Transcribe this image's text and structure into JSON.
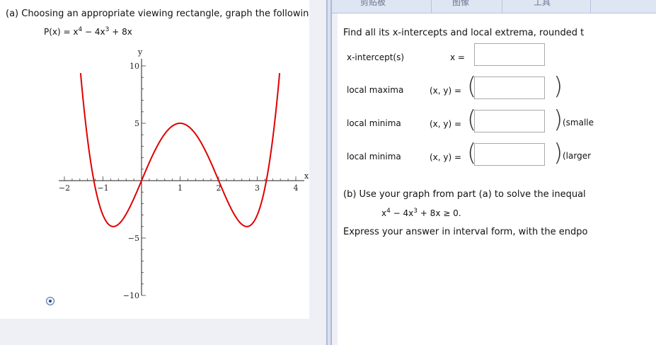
{
  "left": {
    "question_a": "(a) Choosing an appropriate viewing rectangle, graph the followin",
    "function_lhs": "P(x) = x",
    "function_mid": " − 4x",
    "function_rhs": " + 8x",
    "exp4": "4",
    "exp3": "3",
    "radio_selected": true
  },
  "chart_data": {
    "type": "line",
    "function": "x^4 - 4x^3 + 8x",
    "xlabel": "x",
    "ylabel": "y",
    "xlim": [
      -2,
      4
    ],
    "ylim": [
      -10,
      10
    ],
    "x_ticks": [
      "−2",
      "−1",
      "1",
      "2",
      "3",
      "4"
    ],
    "y_ticks": [
      "10",
      "5",
      "−5",
      "−10"
    ],
    "series_color": "#e00000",
    "x_range_plotted": [
      -1.58,
      3.58
    ]
  },
  "ribbon": {
    "item1": "剪贴板",
    "item2": "图像",
    "item3": "工具"
  },
  "right": {
    "prompt": "Find all its x-intercepts and local extrema, rounded t",
    "rows": {
      "xint": {
        "label": "x-intercept(s)",
        "var": "x  ="
      },
      "max": {
        "label": "local maxima",
        "var": "(x, y) ="
      },
      "min1": {
        "label": "local minima",
        "var": "(x, y) =",
        "note": "(smalle"
      },
      "min2": {
        "label": "local minima",
        "var": "(x, y) =",
        "note": "(larger"
      }
    },
    "question_b": "(b) Use your graph from part (a) to solve the inequal",
    "ineq_a": "x",
    "ineq_b": " − 4x",
    "ineq_c": " + 8x ≥ 0.",
    "express": "Express your answer in interval form, with the endpo"
  }
}
